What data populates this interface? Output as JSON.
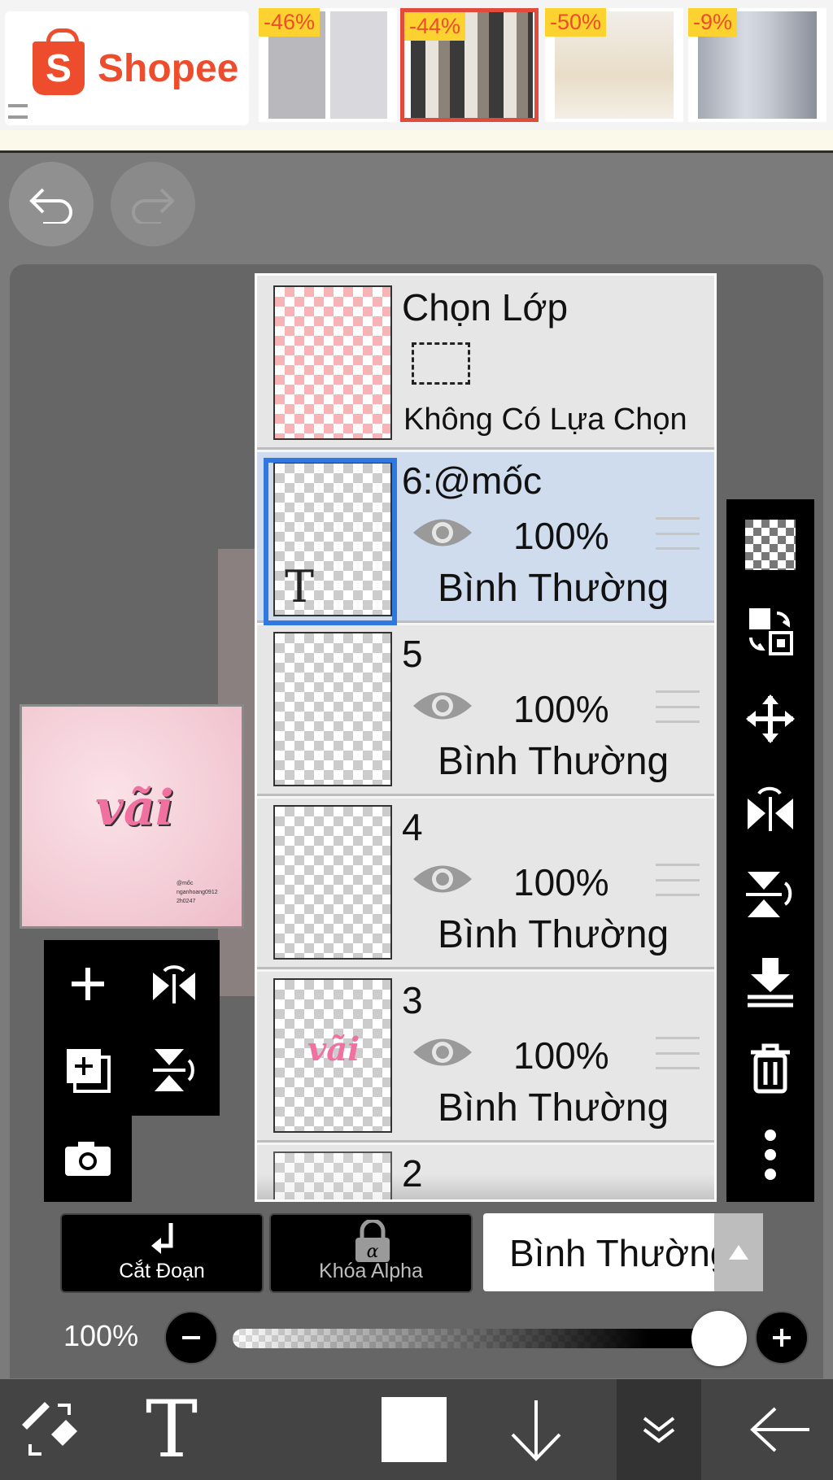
{
  "ad": {
    "brand": "Shopee",
    "brand_letter": "S",
    "products": [
      {
        "discount": "-46%"
      },
      {
        "discount": "-44%"
      },
      {
        "discount": "-50%"
      },
      {
        "discount": "-9%"
      }
    ]
  },
  "layers_panel": {
    "select_layer": {
      "title": "Chọn Lớp",
      "status": "Không Có Lựa Chọn"
    },
    "layers": [
      {
        "name": "6:@mốc",
        "opacity": "100%",
        "mode": "Bình Thường",
        "selected": true
      },
      {
        "name": "5",
        "opacity": "100%",
        "mode": "Bình Thường"
      },
      {
        "name": "4",
        "opacity": "100%",
        "mode": "Bình Thường"
      },
      {
        "name": "3",
        "opacity": "100%",
        "mode": "Bình Thường"
      },
      {
        "name": "2"
      }
    ],
    "text_thumb_letter": "T"
  },
  "preview": {
    "main_text": "vãi",
    "small_text_lines": [
      "@mốc",
      "nganhoang0912",
      "2h0247"
    ]
  },
  "controls": {
    "clipping_label": "Cắt Đoạn",
    "alpha_lock_label": "Khóa Alpha",
    "blend_mode": "Bình Thường"
  },
  "opacity": {
    "label": "100%",
    "value": 1.0
  },
  "bottom_toolbar": {
    "text_tool_glyph": "T"
  },
  "colors": {
    "brand": "#ee4d2d",
    "selection": "#2e78e0",
    "selected_row": "#cfdcee"
  }
}
